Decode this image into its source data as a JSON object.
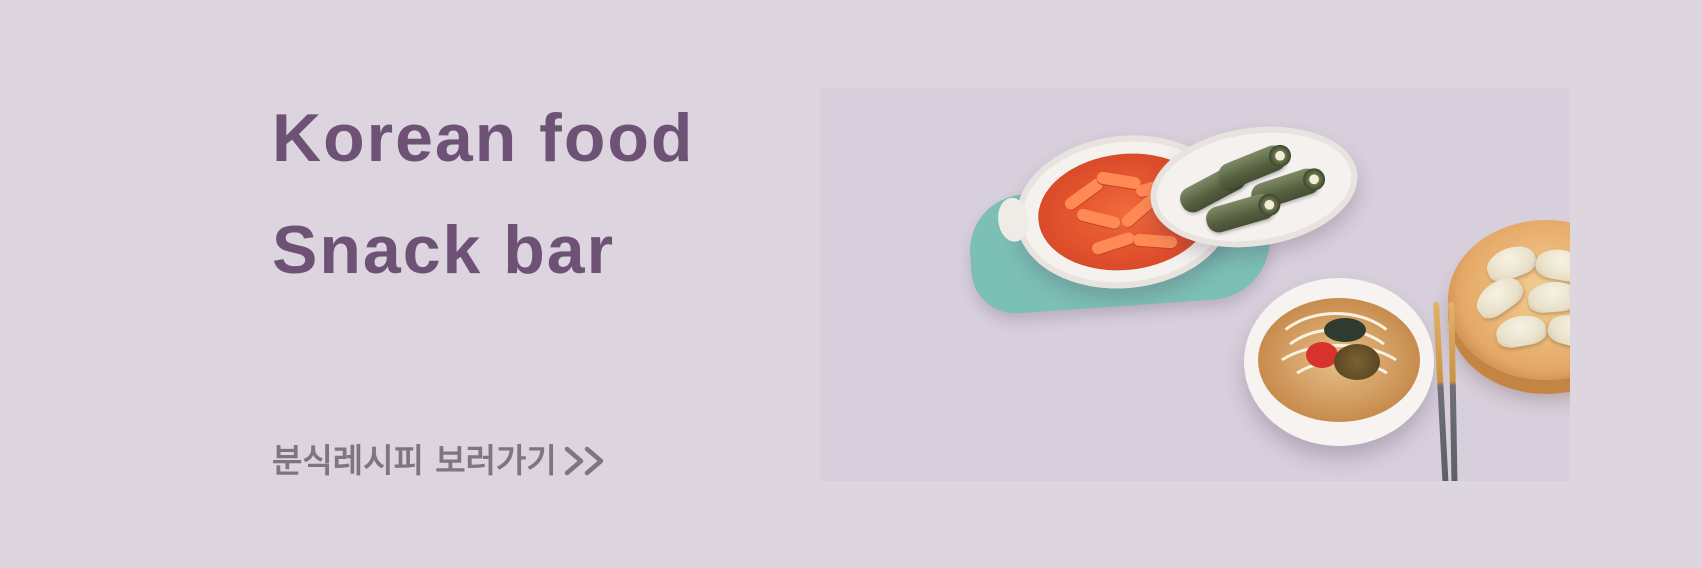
{
  "banner": {
    "title_line_1": "Korean food",
    "title_line_2": "Snack bar",
    "cta_label": "분식레시피 보러가기",
    "cta_chevrons": ">>"
  },
  "colors": {
    "page_bg": "#ddd6df",
    "title": "#6e5276",
    "cta": "#7d7582",
    "placemat": "#7cbfb4"
  },
  "icons": {
    "cta_arrow": "double-chevron-right-icon"
  }
}
